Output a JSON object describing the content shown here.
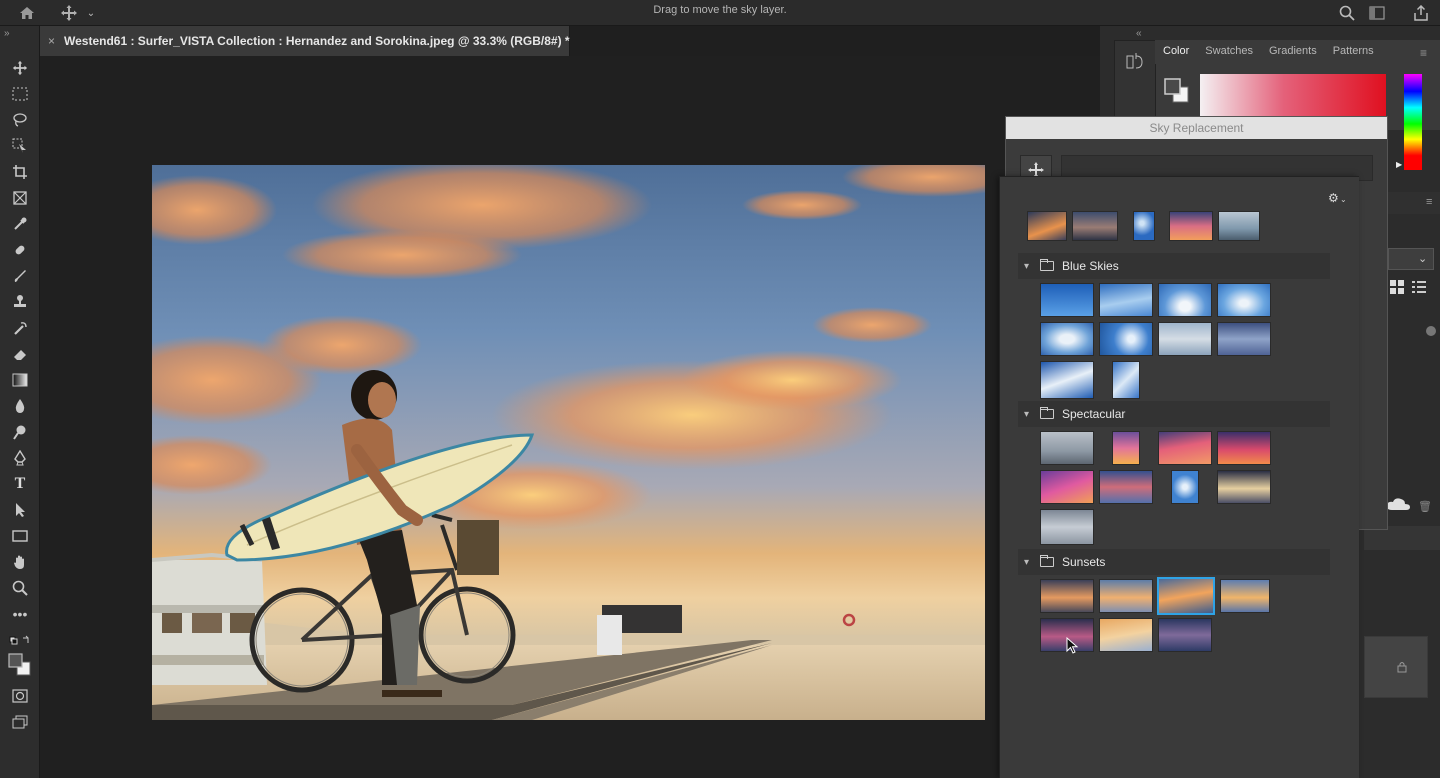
{
  "topbar": {
    "hint": "Drag to move the sky layer.",
    "icons": [
      "home-icon",
      "move-icon",
      "search-icon",
      "workspace-icon",
      "share-icon"
    ]
  },
  "document": {
    "tab_title": "Westend61 : Surfer_VISTA Collection : Hernandez and Sorokina.jpeg @ 33.3% (RGB/8#) *",
    "close_glyph": "×"
  },
  "panels": {
    "tabs": [
      "Color",
      "Swatches",
      "Gradients",
      "Patterns"
    ],
    "active_tab": "Color"
  },
  "sky_replacement": {
    "title": "Sky Replacement",
    "settings_glyph": "⚙",
    "folders": [
      {
        "name": "Blue Skies",
        "expanded": true
      },
      {
        "name": "Spectacular",
        "expanded": true
      },
      {
        "name": "Sunsets",
        "expanded": true
      }
    ]
  },
  "colors": {
    "accent_selected": "#2fa3e6",
    "panel_bg": "#3a3a3a",
    "app_bg": "#1f1f1f"
  }
}
